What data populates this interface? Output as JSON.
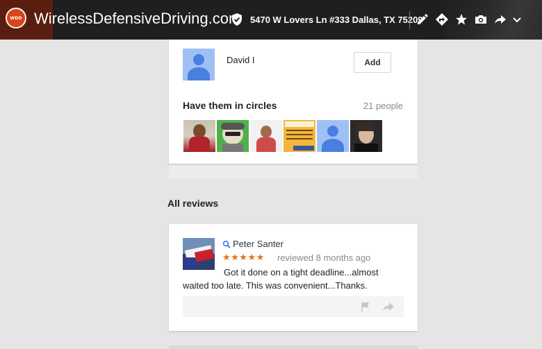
{
  "header": {
    "logo_text": "WDD",
    "site_title": "WirelessDefensiveDriving.com",
    "address": "5470 W Lovers Ln #333 Dallas, TX 75209",
    "icons": [
      "pencil-icon",
      "directions-icon",
      "star-icon",
      "camera-icon",
      "share-icon",
      "chevron-down-icon"
    ]
  },
  "suggested_person": {
    "name": "David I",
    "add_label": "Add"
  },
  "circles": {
    "title": "Have them in circles",
    "count": "21 people"
  },
  "reviews_section": {
    "title": "All reviews"
  },
  "review": {
    "author": "Peter Santer",
    "stars": "★★★★★",
    "meta": "reviewed 8 months ago",
    "text": "Got it done on a tight deadline...almost waited too late. This was convenient...Thanks."
  },
  "colors": {
    "accent_orange": "#e7711b",
    "avatar_blue": "#4a7fe0",
    "topbar": "#1f1f1f"
  }
}
